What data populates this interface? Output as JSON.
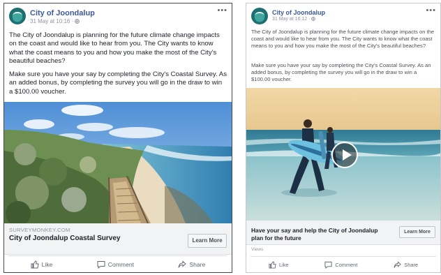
{
  "post1": {
    "page_name": "City of Joondalup",
    "date": "31 May at 10:16 · ",
    "more": "•••",
    "paragraph1": "The City of Joondalup is planning for the future climate change impacts on the coast and would like to hear from you. The City wants to know what the coast means to you and how you make the most of the City's beautiful beaches?",
    "paragraph2": "Make sure you have your say by completing the City's Coastal Survey. As an added bonus, by completing the survey you will go in the draw to win a $100.00 voucher.",
    "link_domain": "SURVEYMONKEY.COM",
    "link_title": "City of Joondalup Coastal Survey",
    "cta_label": "Learn More",
    "actions": {
      "like": "Like",
      "comment": "Comment",
      "share": "Share"
    }
  },
  "post2": {
    "page_name": "City of Joondalup",
    "date": "31 May at 16:12 · ",
    "more": "•••",
    "paragraph1": "The City of Joondalup is planning for the future climate change impacts on the coast and would like to hear from you. The City wants to know what the coast means to you and how you make the most of the City's beautiful beaches?",
    "paragraph2": "Make sure you have your say by completing the City's Coastal Survey. As an added bonus, by completing the survey you will go in the draw to win a $100.00 voucher.",
    "link_title": "Have your say and help the City of Joondalup plan for the future",
    "cta_label": "Learn More",
    "views": "Views",
    "actions": {
      "like": "Like",
      "comment": "Comment",
      "share": "Share"
    }
  },
  "icons": {
    "globe": "globe-icon",
    "like": "thumbs-up-icon",
    "comment": "comment-icon",
    "share": "share-icon",
    "play": "play-icon",
    "more": "more-icon"
  },
  "colors": {
    "brand": "#3b5998",
    "text": "#1d2129",
    "muted": "#606770"
  }
}
